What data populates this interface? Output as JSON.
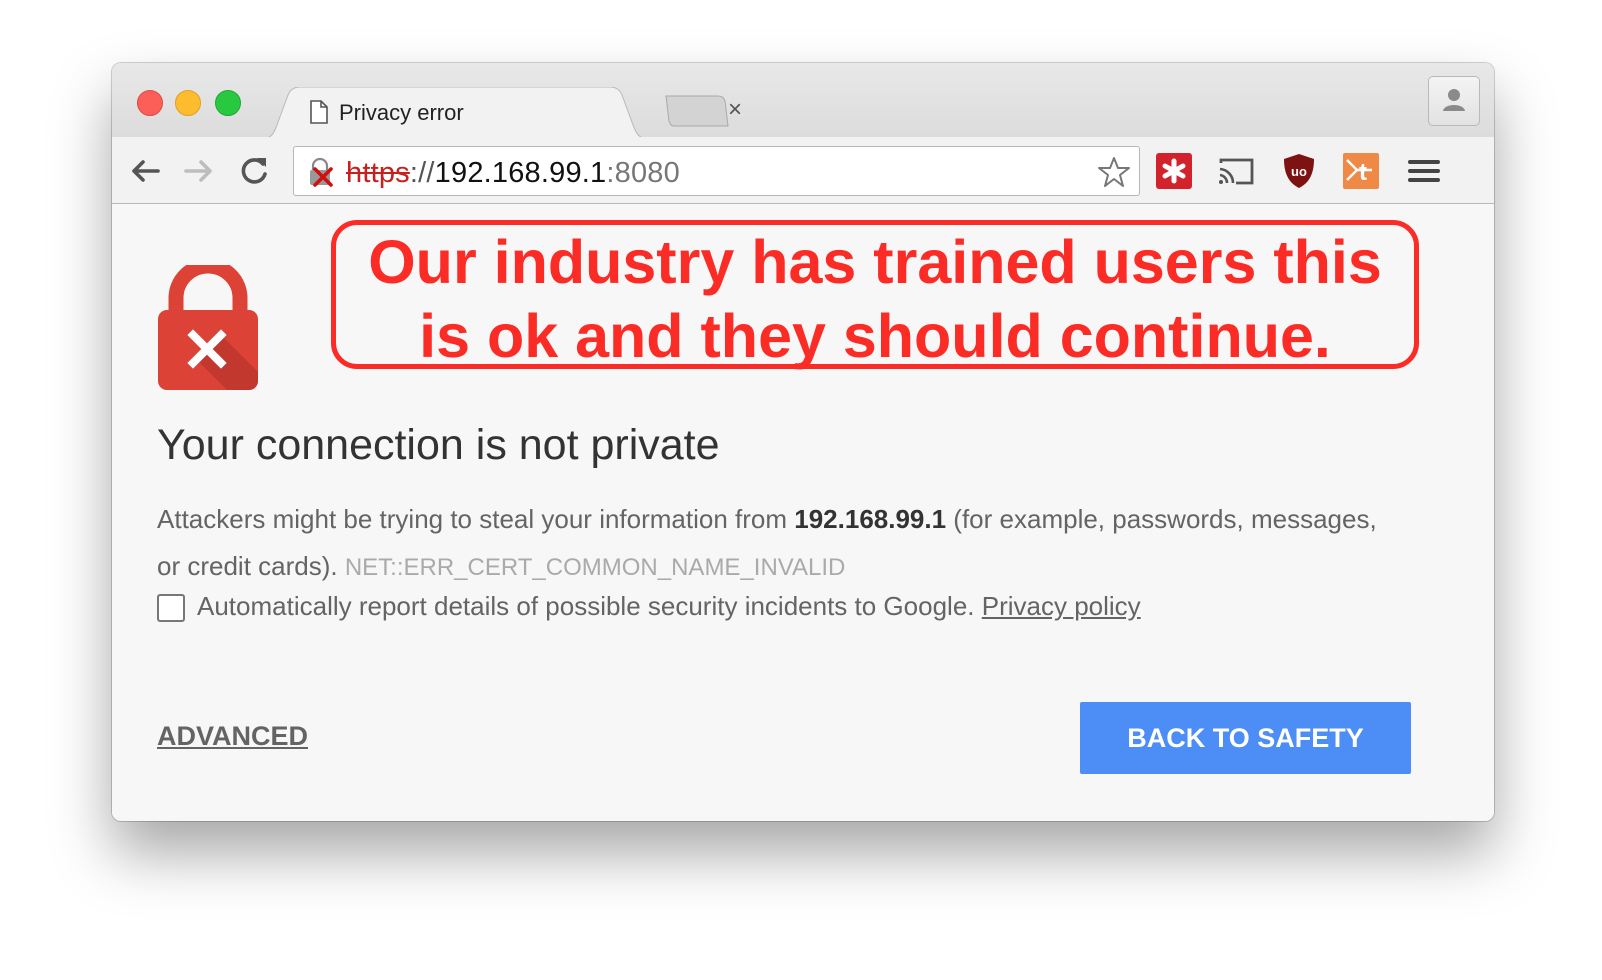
{
  "browser": {
    "tab": {
      "title": "Privacy error",
      "close_glyph": "×",
      "favicon": "document-icon"
    },
    "omnibox": {
      "scheme": "https",
      "separator": "://",
      "host": "192.168.99.1",
      "port": ":8080",
      "security_state": "not-secure-lock-icon"
    },
    "extensions": [
      "red-asterisk-extension-icon",
      "cast-icon",
      "ublock-origin-icon",
      "orange-extension-icon"
    ],
    "colors": {
      "error_red": "#c5221f",
      "button_blue": "#4d8df6"
    }
  },
  "annotation": {
    "line1": "Our industry has trained users this",
    "line2": "is ok and they should continue.",
    "color": "#fb2b26"
  },
  "interstitial": {
    "heading": "Your connection is not private",
    "desc_prefix": "Attackers might be trying to steal your information from ",
    "desc_host": "192.168.99.1",
    "desc_suffix": " (for example, passwords, messages, or credit cards). ",
    "error_code": "NET::ERR_CERT_COMMON_NAME_INVALID",
    "report_text": "Automatically report details of possible security incidents to Google. ",
    "privacy_link": "Privacy policy",
    "advanced_label": "ADVANCED",
    "back_label": "BACK TO SAFETY"
  }
}
